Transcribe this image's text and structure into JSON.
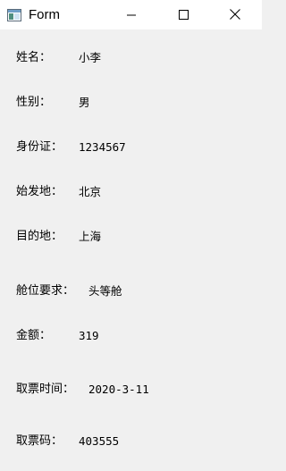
{
  "window": {
    "title": "Form",
    "icon": "form-app-icon",
    "controls": {
      "minimize_icon": "minimize-icon",
      "maximize_icon": "maximize-icon",
      "close_icon": "close-icon"
    }
  },
  "ticket": {
    "name": {
      "label": "姓名：",
      "value": "小李"
    },
    "gender": {
      "label": "性别：",
      "value": "男"
    },
    "id_card": {
      "label": "身份证：",
      "value": "1234567"
    },
    "origin": {
      "label": "始发地：",
      "value": "北京"
    },
    "destination": {
      "label": "目的地：",
      "value": "上海"
    },
    "cabin": {
      "label": "舱位要求：",
      "value": "头等舱"
    },
    "amount": {
      "label": "金额：",
      "value": "319"
    },
    "pickup_time": {
      "label": "取票时间：",
      "value": "2020-3-11"
    },
    "pickup_code": {
      "label": "取票码：",
      "value": "403555"
    }
  }
}
